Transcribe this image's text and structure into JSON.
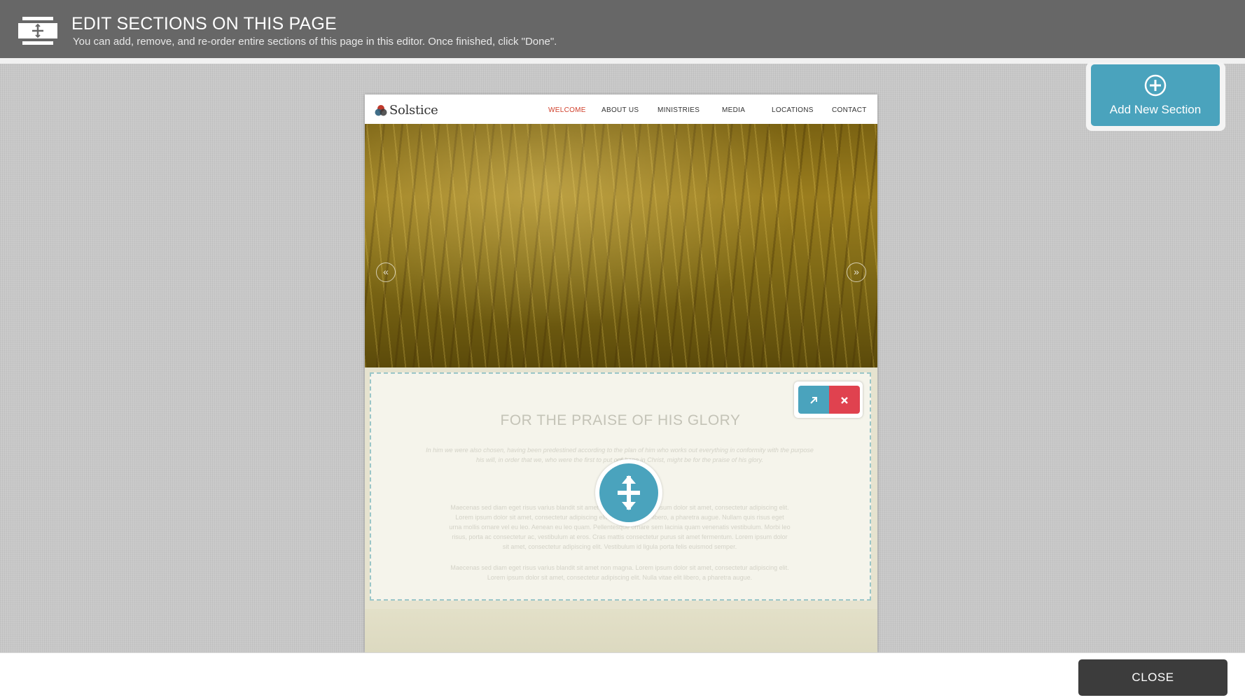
{
  "header": {
    "title": "EDIT SECTIONS ON THIS PAGE",
    "subtitle": "You can add, remove, and re-order entire sections of this page in this editor. Once finished, click \"Done\"."
  },
  "preview": {
    "logo_text": "Solstice",
    "nav": [
      "WELCOME",
      "ABOUT US",
      "MINISTRIES",
      "MEDIA",
      "LOCATIONS",
      "CONTACT"
    ],
    "active_nav": "WELCOME",
    "hero_prev": "«",
    "hero_next": "»",
    "section": {
      "title": "FOR THE PRAISE OF HIS GLORY",
      "intro_line1": "In him we were also chosen, having been predestined according to the plan of him who works out everything in conformity with the purpose of",
      "intro_line2": "his will, in order that we, who were the first to put our hope in Christ, might be for the praise of his glory.",
      "para1_line1": "Maecenas sed diam eget risus varius blandit sit amet non magna. Lorem ipsum dolor sit amet, consectetur adipiscing elit.",
      "para1_line2": "Lorem ipsum dolor sit amet, consectetur adipiscing elit. Nulla vitae elit libero, a pharetra augue. Nullam quis risus eget",
      "para1_line3": "urna mollis ornare vel eu leo. Aenean eu leo quam. Pellentesque ornare sem lacinia quam venenatis vestibulum. Morbi leo",
      "para1_line4": "risus, porta ac consectetur ac, vestibulum at eros. Cras mattis consectetur purus sit amet fermentum. Lorem ipsum dolor",
      "para1_line5": "sit amet, consectetur adipiscing elit. Vestibulum id ligula porta felis euismod semper.",
      "para2_line1": "Maecenas sed diam eget risus varius blandit sit amet non magna. Lorem ipsum dolor sit amet, consectetur adipiscing elit.",
      "para2_line2": "Lorem ipsum dolor sit amet, consectetur adipiscing elit. Nulla vitae elit libero, a pharetra augue."
    }
  },
  "tools": {
    "move_icon": "arrow-up-right-icon",
    "delete_icon": "close-icon"
  },
  "add_section": {
    "label": "Add New Section",
    "icon": "plus-circle-icon"
  },
  "footer": {
    "close_label": "CLOSE"
  },
  "colors": {
    "accent": "#4aa3bd",
    "danger": "#e0424f",
    "header_bg": "#676767",
    "active_nav": "#d0402c",
    "close_bg": "#3c3c3c"
  }
}
